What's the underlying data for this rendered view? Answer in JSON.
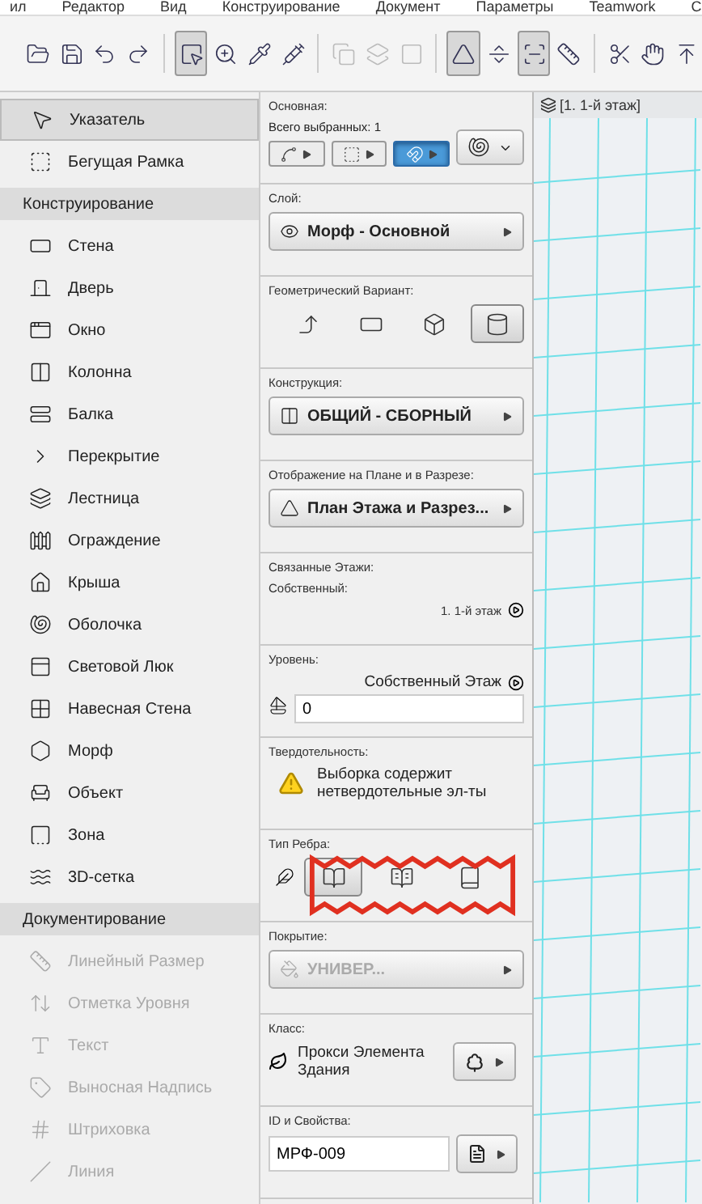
{
  "menu": [
    "ил",
    "Редактор",
    "Вид",
    "Конструирование",
    "Документ",
    "Параметры",
    "Teamwork",
    "С"
  ],
  "toolbar": [
    {
      "selected": false,
      "disabled": false
    },
    {
      "selected": false,
      "disabled": false
    },
    {
      "selected": false,
      "disabled": false
    },
    {
      "selected": false,
      "disabled": false
    },
    {
      "selected": true,
      "disabled": false
    },
    {
      "selected": false,
      "disabled": false
    },
    {
      "selected": false,
      "disabled": false
    },
    {
      "selected": false,
      "disabled": false
    },
    {
      "selected": false,
      "disabled": true
    },
    {
      "selected": false,
      "disabled": true
    },
    {
      "selected": false,
      "disabled": true
    },
    {
      "selected": true,
      "disabled": false
    },
    {
      "selected": false,
      "disabled": false
    },
    {
      "selected": true,
      "disabled": false
    },
    {
      "selected": false,
      "disabled": false
    },
    {
      "selected": false,
      "disabled": false
    },
    {
      "selected": false,
      "disabled": false
    },
    {
      "selected": false,
      "disabled": false
    }
  ],
  "toolbox": [
    {
      "kind": "tool",
      "label": "Указатель",
      "selected": true,
      "disabled": false
    },
    {
      "kind": "tool",
      "label": "Бегущая Рамка",
      "selected": false,
      "disabled": false
    },
    {
      "kind": "header",
      "label": "Конструирование"
    },
    {
      "kind": "tool",
      "label": "Стена",
      "selected": false,
      "disabled": false
    },
    {
      "kind": "tool",
      "label": "Дверь",
      "selected": false,
      "disabled": false
    },
    {
      "kind": "tool",
      "label": "Окно",
      "selected": false,
      "disabled": false
    },
    {
      "kind": "tool",
      "label": "Колонна",
      "selected": false,
      "disabled": false
    },
    {
      "kind": "tool",
      "label": "Балка",
      "selected": false,
      "disabled": false
    },
    {
      "kind": "tool",
      "label": "Перекрытие",
      "selected": false,
      "disabled": false
    },
    {
      "kind": "tool",
      "label": "Лестница",
      "selected": false,
      "disabled": false
    },
    {
      "kind": "tool",
      "label": "Ограждение",
      "selected": false,
      "disabled": false
    },
    {
      "kind": "tool",
      "label": "Крыша",
      "selected": false,
      "disabled": false
    },
    {
      "kind": "tool",
      "label": "Оболочка",
      "selected": false,
      "disabled": false
    },
    {
      "kind": "tool",
      "label": "Световой Люк",
      "selected": false,
      "disabled": false
    },
    {
      "kind": "tool",
      "label": "Навесная Стена",
      "selected": false,
      "disabled": false
    },
    {
      "kind": "tool",
      "label": "Морф",
      "selected": false,
      "disabled": false
    },
    {
      "kind": "tool",
      "label": "Объект",
      "selected": false,
      "disabled": false
    },
    {
      "kind": "tool",
      "label": "Зона",
      "selected": false,
      "disabled": false
    },
    {
      "kind": "tool",
      "label": "3D-сетка",
      "selected": false,
      "disabled": false
    },
    {
      "kind": "header",
      "label": "Документирование"
    },
    {
      "kind": "tool",
      "label": "Линейный Размер",
      "selected": false,
      "disabled": true
    },
    {
      "kind": "tool",
      "label": "Отметка Уровня",
      "selected": false,
      "disabled": true
    },
    {
      "kind": "tool",
      "label": "Текст",
      "selected": false,
      "disabled": true
    },
    {
      "kind": "tool",
      "label": "Выносная Надпись",
      "selected": false,
      "disabled": true
    },
    {
      "kind": "tool",
      "label": "Штриховка",
      "selected": false,
      "disabled": true
    },
    {
      "kind": "tool",
      "label": "Линия",
      "selected": false,
      "disabled": true
    }
  ],
  "info": [
    {
      "kind": "basic",
      "label": "Основная:",
      "count": "Всего выбранных: 1",
      "buttons": [
        {
          "selected": false
        },
        {
          "selected": false
        },
        {
          "selected": true
        }
      ]
    },
    {
      "kind": "select",
      "label": "Слой:",
      "value": "Морф - Основной",
      "disabled": false
    },
    {
      "kind": "options",
      "label": "Геометрический Вариант:",
      "highlighted": false,
      "options": [
        {
          "selected": false
        },
        {
          "selected": false
        },
        {
          "selected": false
        },
        {
          "selected": true
        }
      ]
    },
    {
      "kind": "select",
      "label": "Конструкция:",
      "value": "ОБЩИЙ - СБОРНЫЙ",
      "disabled": false
    },
    {
      "kind": "select",
      "label": "Отображение на Плане и в Разрезе:",
      "value": "План Этажа и Разрез...",
      "disabled": false
    },
    {
      "kind": "stories",
      "label": "Связанные Этажи:",
      "sublabel": "Собственный:",
      "value": "1. 1-й этаж"
    },
    {
      "kind": "level",
      "label": "Уровень:",
      "reference": "Собственный Этаж",
      "value": "0"
    },
    {
      "kind": "note",
      "label": "Твердотельность:",
      "text": "Выборка содержит нетвердотельные эл-ты"
    },
    {
      "kind": "options",
      "label": "Тип Ребра:",
      "highlighted": true,
      "options": [
        {
          "selected": true
        },
        {
          "selected": false
        },
        {
          "selected": false
        }
      ]
    },
    {
      "kind": "select",
      "label": "Покрытие:",
      "value": "УНИВЕР...",
      "disabled": true
    },
    {
      "kind": "class",
      "label": "Класс:",
      "value": "Прокси Элемента Здания"
    },
    {
      "kind": "id",
      "label": "ID и Свойства:",
      "value": "МРФ-009"
    }
  ],
  "view_tab": "[1. 1-й этаж]"
}
